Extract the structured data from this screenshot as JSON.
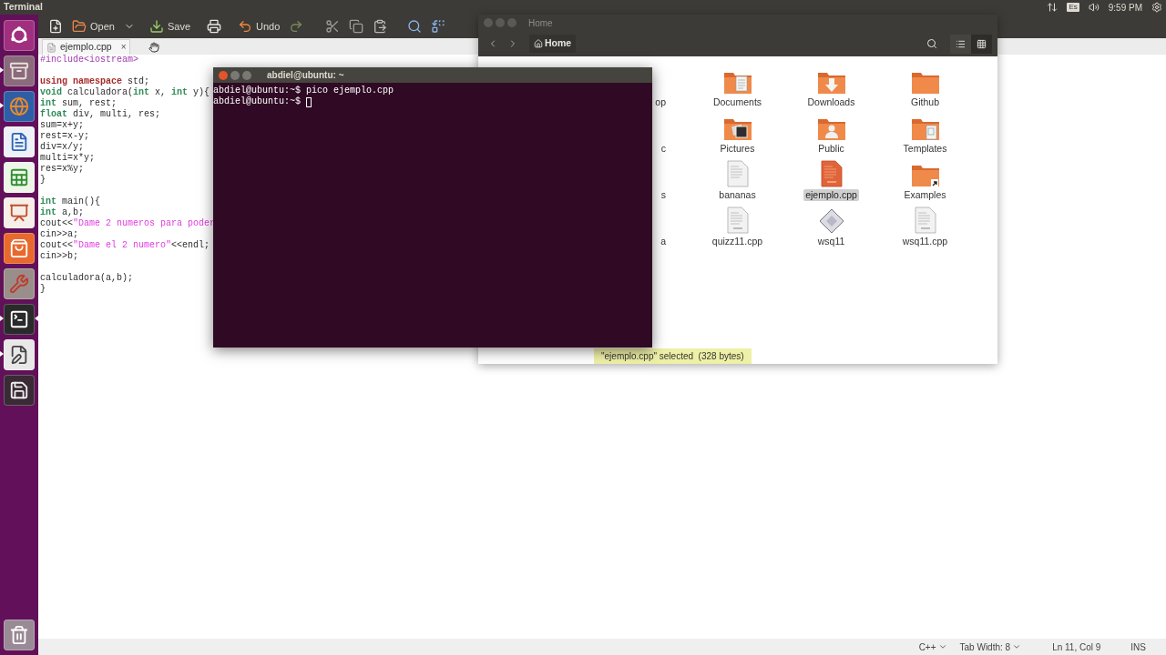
{
  "top_panel": {
    "title": "Terminal",
    "keyboard": "Es",
    "clock": "9:59 PM"
  },
  "launcher": [
    {
      "kind": "dash",
      "running": false,
      "focused": false
    },
    {
      "kind": "files",
      "running": true,
      "focused": false
    },
    {
      "kind": "browser",
      "running": true,
      "focused": false
    },
    {
      "kind": "writer",
      "running": false,
      "focused": false
    },
    {
      "kind": "calc",
      "running": false,
      "focused": false
    },
    {
      "kind": "impress",
      "running": false,
      "focused": false
    },
    {
      "kind": "store",
      "running": false,
      "focused": false
    },
    {
      "kind": "settings",
      "running": false,
      "focused": false
    },
    {
      "kind": "terminal",
      "running": true,
      "focused": true
    },
    {
      "kind": "editor",
      "running": true,
      "focused": false
    },
    {
      "kind": "disk",
      "running": false,
      "focused": false
    },
    {
      "kind": "trash",
      "running": false,
      "focused": false
    }
  ],
  "editor": {
    "toolbar": [
      {
        "kind": "new"
      },
      {
        "kind": "open",
        "label": "Open"
      },
      {
        "kind": "save",
        "label": "Save"
      },
      {
        "kind": "print"
      },
      {
        "kind": "undo",
        "label": "Undo"
      },
      {
        "kind": "redo"
      },
      {
        "kind": "cut"
      },
      {
        "kind": "copy"
      },
      {
        "kind": "paste"
      },
      {
        "kind": "find"
      },
      {
        "kind": "replace"
      }
    ],
    "tab": {
      "label": "ejemplo.cpp",
      "close": "×"
    },
    "lines": [
      {
        "tokens": [
          {
            "kind": "preproc",
            "text": "#include<iostream>"
          }
        ]
      },
      {
        "spaced": true,
        "tokens": [
          {
            "kind": "keyword",
            "text": "using namespace"
          },
          {
            "kind": "plain",
            "text": " std;"
          }
        ]
      },
      {
        "tokens": [
          {
            "kind": "type",
            "text": "void"
          },
          {
            "kind": "plain",
            "text": " calculadora("
          },
          {
            "kind": "type",
            "text": "int"
          },
          {
            "kind": "plain",
            "text": " x, "
          },
          {
            "kind": "type",
            "text": "int"
          },
          {
            "kind": "plain",
            "text": " y){"
          }
        ]
      },
      {
        "tokens": [
          {
            "kind": "type",
            "text": "int"
          },
          {
            "kind": "plain",
            "text": " sum, rest;"
          }
        ]
      },
      {
        "tokens": [
          {
            "kind": "type",
            "text": "float"
          },
          {
            "kind": "plain",
            "text": " div, multi, res;"
          }
        ]
      },
      {
        "tokens": [
          {
            "kind": "plain",
            "text": "sum=x+y;"
          }
        ]
      },
      {
        "tokens": [
          {
            "kind": "plain",
            "text": "rest=x-y;"
          }
        ]
      },
      {
        "tokens": [
          {
            "kind": "plain",
            "text": "div=x/y;"
          }
        ]
      },
      {
        "tokens": [
          {
            "kind": "plain",
            "text": "multi=x*y;"
          }
        ]
      },
      {
        "tokens": [
          {
            "kind": "plain",
            "text": "res=x%y;"
          }
        ]
      },
      {
        "tokens": [
          {
            "kind": "plain",
            "text": "}"
          }
        ]
      },
      {
        "spaced": true,
        "tokens": [
          {
            "kind": "type",
            "text": "int"
          },
          {
            "kind": "plain",
            "text": " main(){"
          }
        ]
      },
      {
        "tokens": [
          {
            "kind": "type",
            "text": "int"
          },
          {
            "kind": "plain",
            "text": " a,b;"
          }
        ]
      },
      {
        "tokens": [
          {
            "kind": "plain",
            "text": "cout<<"
          },
          {
            "kind": "string",
            "text": "\"Dame 2 numeros para poder"
          }
        ]
      },
      {
        "tokens": [
          {
            "kind": "plain",
            "text": "cin>>a;"
          }
        ]
      },
      {
        "tokens": [
          {
            "kind": "plain",
            "text": "cout<<"
          },
          {
            "kind": "string",
            "text": "\"Dame el 2 numero\""
          },
          {
            "kind": "plain",
            "text": "<<endl;"
          }
        ]
      },
      {
        "tokens": [
          {
            "kind": "plain",
            "text": "cin>>b;"
          }
        ]
      },
      {
        "spaced": true,
        "tokens": [
          {
            "kind": "plain",
            "text": "calculadora(a,b);"
          }
        ]
      },
      {
        "tokens": [
          {
            "kind": "plain",
            "text": "}"
          }
        ]
      }
    ],
    "status_bar": {
      "language": "C++",
      "tab_width": "Tab Width: 8",
      "position": "Ln 11, Col 9",
      "mode": "INS"
    }
  },
  "files": {
    "title": "Home",
    "path_button": "Home",
    "views": [
      {
        "kind": "list",
        "selected": false
      },
      {
        "kind": "grid",
        "selected": true
      }
    ],
    "items": [
      {
        "kind": "cut",
        "label": "op"
      },
      {
        "kind": "folder-documents",
        "label": "Documents",
        "selected": false
      },
      {
        "kind": "folder-downloads",
        "label": "Downloads",
        "selected": false
      },
      {
        "kind": "folder",
        "label": "Github",
        "selected": false
      },
      {
        "kind": "cut",
        "label": "c"
      },
      {
        "kind": "folder-pictures",
        "label": "Pictures",
        "selected": false
      },
      {
        "kind": "folder-public",
        "label": "Public",
        "selected": false
      },
      {
        "kind": "folder-templates",
        "label": "Templates",
        "selected": false
      },
      {
        "kind": "cut",
        "label": "s"
      },
      {
        "kind": "text",
        "label": "bananas",
        "selected": false
      },
      {
        "kind": "source",
        "label": "ejemplo.cpp",
        "selected": true
      },
      {
        "kind": "folder-link",
        "label": "Examples",
        "selected": false
      },
      {
        "kind": "cut",
        "label": "a"
      },
      {
        "kind": "source",
        "label": "quizz11.cpp",
        "selected": false
      },
      {
        "kind": "program",
        "label": "wsq11",
        "selected": false
      },
      {
        "kind": "source",
        "label": "wsq11.cpp",
        "selected": false
      }
    ],
    "status": "\"ejemplo.cpp\" selected  (328 bytes)"
  },
  "terminal": {
    "title": "abdiel@ubuntu: ~",
    "lines": [
      "abdiel@ubuntu:~$ pico ejemplo.cpp",
      "abdiel@ubuntu:~$ "
    ]
  }
}
